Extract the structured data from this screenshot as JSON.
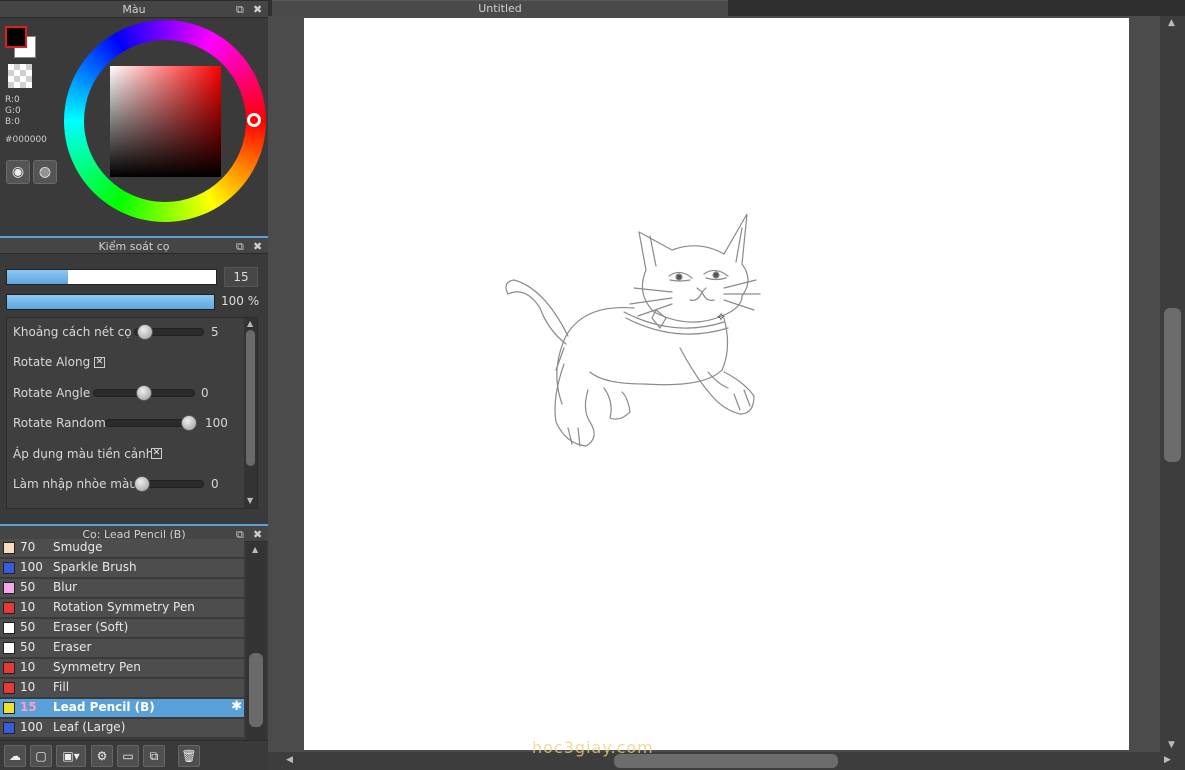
{
  "panels": {
    "color": {
      "title": "Màu"
    },
    "brush_control": {
      "title": "Kiểm soát cọ"
    },
    "brush_list": {
      "title": "Cọ: Lead Pencil (B)"
    }
  },
  "color": {
    "r_label": "R:0",
    "g_label": "G:0",
    "b_label": "B:0",
    "hex": "#000000",
    "foreground": "#000000",
    "background": "#ffffff"
  },
  "brush_control": {
    "size_value": "15",
    "opacity_value": "100 %",
    "size_fraction": 0.29,
    "opacity_fraction": 1.0,
    "properties": [
      {
        "label": "Khoảng cách nét cọ",
        "type": "slider",
        "value": "5",
        "fraction": 0.05
      },
      {
        "label": "Rotate Along",
        "type": "checkbox",
        "checked": true
      },
      {
        "label": "Rotate Angle",
        "type": "slider",
        "value": "0",
        "fraction": 0.5
      },
      {
        "label": "Rotate Random",
        "type": "slider",
        "value": "100",
        "fraction": 1.0
      },
      {
        "label": "Áp dụng màu tiền cảnh",
        "type": "checkbox",
        "checked": true
      },
      {
        "label": "Làm nhập nhòe màu",
        "type": "slider",
        "value": "0",
        "fraction": 0.0
      }
    ]
  },
  "brushes": [
    {
      "size": "70",
      "name": "Smudge",
      "color": "#f7dcc0"
    },
    {
      "size": "100",
      "name": "Sparkle Brush",
      "color": "#3a5ae0"
    },
    {
      "size": "50",
      "name": "Blur",
      "color": "#f4a8e8"
    },
    {
      "size": "10",
      "name": "Rotation Symmetry Pen",
      "color": "#e83838"
    },
    {
      "size": "50",
      "name": "Eraser (Soft)",
      "color": "#ffffff"
    },
    {
      "size": "50",
      "name": "Eraser",
      "color": "#ffffff"
    },
    {
      "size": "10",
      "name": "Symmetry Pen",
      "color": "#e83838"
    },
    {
      "size": "10",
      "name": "Fill",
      "color": "#e83838"
    },
    {
      "size": "15",
      "name": "Lead Pencil (B)",
      "color": "#f0e030",
      "selected": true
    },
    {
      "size": "100",
      "name": "Leaf (Large)",
      "color": "#3a5ae0"
    }
  ],
  "canvas": {
    "tab_title": "Untitled",
    "watermark": "hoc3giay.com"
  },
  "icons": {
    "detach": "⧉",
    "close": "✖",
    "palette": "🎨",
    "gear": "✱"
  }
}
